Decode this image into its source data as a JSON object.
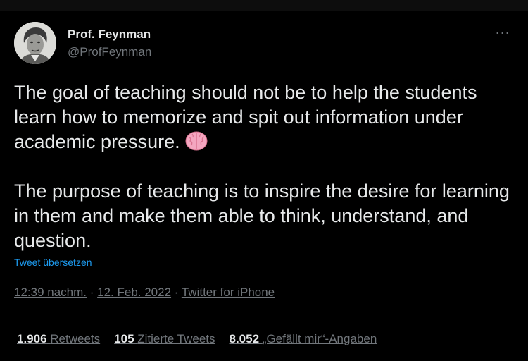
{
  "author": {
    "name": "Prof. Feynman",
    "handle": "@ProfFeynman",
    "avatar_icon": "portrait-avatar-icon"
  },
  "more_menu": {
    "label": "···",
    "icon": "more-options-icon"
  },
  "tweet": {
    "paragraphs": [
      "The goal of teaching should not be to help the students learn how to memorize and spit out information under academic pressure.",
      "The purpose of teaching is to inspire the desire for learning in them and make them able to think, understand, and question."
    ],
    "emoji": "brain-emoji-icon"
  },
  "translate_label": "Tweet übersetzen",
  "meta": {
    "time": "12:39 nachm.",
    "separator1": " · ",
    "date": "12. Feb. 2022",
    "separator2": " · ",
    "source": "Twitter for iPhone"
  },
  "stats": {
    "retweets": {
      "count": "1.906",
      "label": "Retweets"
    },
    "quotes": {
      "count": "105",
      "label": "Zitierte Tweets"
    },
    "likes": {
      "count": "8.052",
      "label": "„Gefällt mir“-Angaben"
    }
  },
  "colors": {
    "background": "#000000",
    "text": "#e7e9ea",
    "secondary": "#71767b",
    "link": "#1d9bf0",
    "divider": "#2f3336"
  }
}
